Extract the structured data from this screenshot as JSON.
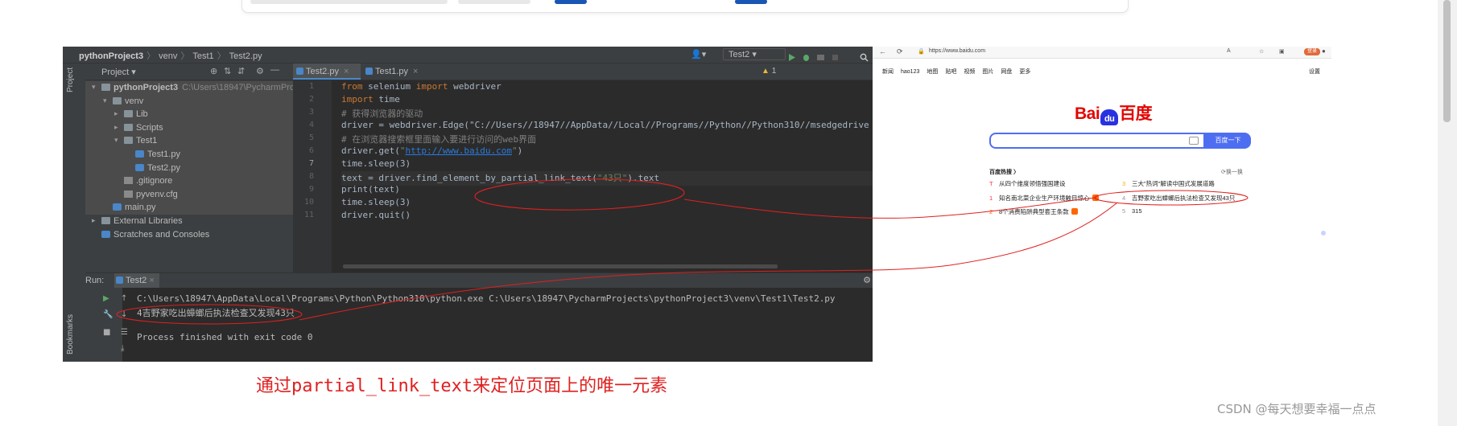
{
  "ide": {
    "breadcrumb": [
      "pythonProject3",
      "venv",
      "Test1",
      "Test2.py"
    ],
    "run_config": "Test2",
    "project_panel": {
      "title": "Project",
      "tree": [
        {
          "label": "pythonProject3",
          "path": "C:\\Users\\18947\\PycharmProje",
          "depth": 0,
          "kind": "folder",
          "expanded": true
        },
        {
          "label": "venv",
          "depth": 1,
          "kind": "folder",
          "expanded": true
        },
        {
          "label": "Lib",
          "depth": 2,
          "kind": "folder",
          "expanded": false
        },
        {
          "label": "Scripts",
          "depth": 2,
          "kind": "folder",
          "expanded": false
        },
        {
          "label": "Test1",
          "depth": 2,
          "kind": "folder",
          "expanded": true
        },
        {
          "label": "Test1.py",
          "depth": 3,
          "kind": "py"
        },
        {
          "label": "Test2.py",
          "depth": 3,
          "kind": "py"
        },
        {
          "label": ".gitignore",
          "depth": 2,
          "kind": "git"
        },
        {
          "label": "pyvenv.cfg",
          "depth": 2,
          "kind": "cfg"
        },
        {
          "label": "main.py",
          "depth": 1,
          "kind": "py"
        },
        {
          "label": "External Libraries",
          "depth": 0,
          "kind": "lib",
          "expanded": false
        },
        {
          "label": "Scratches and Consoles",
          "depth": 0,
          "kind": "scratch"
        }
      ]
    },
    "tabs": [
      "Test2.py",
      "Test1.py"
    ],
    "active_tab": "Test2.py",
    "warnings": "1",
    "current_line": 7,
    "code_lines": [
      "from selenium import webdriver",
      "import time",
      "# 获得浏览器的驱动",
      "driver = webdriver.Edge(\"C://Users//18947//AppData//Local//Programs//Python//Python310//msedgedrive",
      "# 在浏览器搜索框里面输入要进行访问的web界面",
      "driver.get(\"http://www.baidu.com\")",
      "time.sleep(3)",
      "text = driver.find_element_by_partial_link_text(\"43只\").text",
      "print(text)",
      "time.sleep(3)",
      "driver.quit()"
    ],
    "run_panel": {
      "label": "Run:",
      "tab": "Test2",
      "output": [
        "C:\\Users\\18947\\AppData\\Local\\Programs\\Python\\Python310\\python.exe C:\\Users\\18947\\PycharmProjects\\pythonProject3\\venv\\Test1\\Test2.py",
        "4吉野家吃出蟑螂后执法检查又发现43只",
        "",
        "Process finished with exit code 0"
      ]
    }
  },
  "browser": {
    "url": "https://www.baidu.com",
    "account": "登录",
    "nav": [
      "新闻",
      "hao123",
      "地图",
      "贴吧",
      "视频",
      "图片",
      "网盘",
      "更多"
    ],
    "settings": "设置",
    "logo_text": {
      "left": "Bai",
      "paw": "du",
      "right": "百度"
    },
    "search_button": "百度一下",
    "hot_title": "百度热搜",
    "refresh": "换一换",
    "hot_left": [
      {
        "rank": "T",
        "text": "从四个维度领悟强国建设",
        "tag": false,
        "style": "red"
      },
      {
        "rank": "1",
        "text": "知名南北菜企业生产环境触目惊心",
        "tag": true,
        "style": "red"
      },
      {
        "rank": "2",
        "text": "8个消费陷阱典型套王条款",
        "tag": true,
        "style": "org"
      }
    ],
    "hot_right": [
      {
        "rank": "3",
        "text": "三大\"热词\"解读中国式发展道路",
        "tag": false,
        "style": "yel"
      },
      {
        "rank": "4",
        "text": "吉野家吃出蟑螂后执法检查又发现43只",
        "tag": false,
        "style": "gry"
      },
      {
        "rank": "5",
        "text": "315",
        "tag": false,
        "style": "gry"
      }
    ]
  },
  "caption": "通过partial_link_text来定位页面上的唯一元素",
  "watermark": "CSDN @每天想要幸福一点点"
}
